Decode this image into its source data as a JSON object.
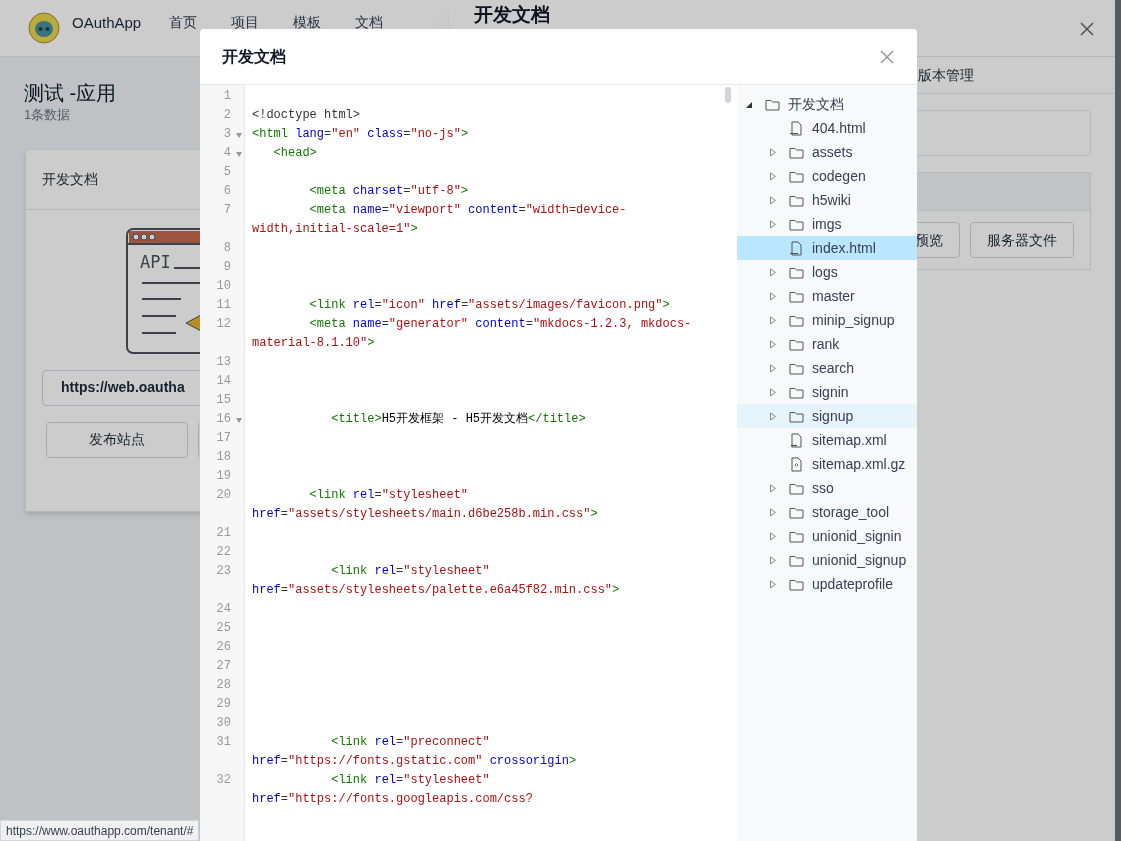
{
  "app": {
    "name": "OAuthApp",
    "nav": [
      {
        "label": "首页"
      },
      {
        "label": "项目"
      },
      {
        "label": "模板"
      },
      {
        "label": "文档"
      }
    ]
  },
  "page": {
    "title": "测试 -应用",
    "subtitle": "1条数据"
  },
  "card": {
    "title": "开发文档",
    "illustration_label": "API",
    "url_button": "https://web.oautha",
    "buttons": [
      "发布站点"
    ]
  },
  "drawer": {
    "title": "开发文档",
    "tabs": [
      {
        "label": "版本管理",
        "selected": false
      }
    ],
    "buttons": [
      "预览",
      "服务器文件"
    ]
  },
  "modal": {
    "title": "开发文档",
    "code_lines": [
      {
        "number": "1",
        "foldable": false
      },
      {
        "number": "2",
        "foldable": false,
        "segments": [
          {
            "kind": "plain",
            "text": "<!doctype html>"
          }
        ]
      },
      {
        "number": "3",
        "foldable": true,
        "segments": [
          {
            "kind": "tag",
            "text": "<html"
          },
          {
            "kind": "attr",
            "text": " lang"
          },
          {
            "kind": "plain",
            "text": "="
          },
          {
            "kind": "value",
            "text": "\"en\""
          },
          {
            "kind": "attr",
            "text": " class"
          },
          {
            "kind": "plain",
            "text": "="
          },
          {
            "kind": "value",
            "text": "\"no-js\""
          },
          {
            "kind": "tag",
            "text": ">"
          }
        ]
      },
      {
        "number": "4",
        "foldable": true,
        "segments": [
          {
            "kind": "tag",
            "text": "   <head>"
          }
        ]
      },
      {
        "number": "5",
        "foldable": false
      },
      {
        "number": "6",
        "foldable": false,
        "segments": [
          {
            "kind": "tag",
            "text": "        <meta"
          },
          {
            "kind": "attr",
            "text": " charset"
          },
          {
            "kind": "plain",
            "text": "="
          },
          {
            "kind": "value",
            "text": "\"utf-8\""
          },
          {
            "kind": "tag",
            "text": ">"
          }
        ]
      },
      {
        "number": "7",
        "foldable": false,
        "segments": [
          {
            "kind": "tag",
            "text": "        <meta"
          },
          {
            "kind": "attr",
            "text": " name"
          },
          {
            "kind": "plain",
            "text": "="
          },
          {
            "kind": "value",
            "text": "\"viewport\""
          },
          {
            "kind": "attr",
            "text": " content"
          },
          {
            "kind": "plain",
            "text": "="
          },
          {
            "kind": "value",
            "text": "\"width=device-width,initial-scale=1\""
          },
          {
            "kind": "tag",
            "text": ">"
          }
        ]
      },
      {
        "number": "8",
        "foldable": false
      },
      {
        "number": "9",
        "foldable": false
      },
      {
        "number": "10",
        "foldable": false
      },
      {
        "number": "11",
        "foldable": false,
        "segments": [
          {
            "kind": "tag",
            "text": "        <link"
          },
          {
            "kind": "attr",
            "text": " rel"
          },
          {
            "kind": "plain",
            "text": "="
          },
          {
            "kind": "value",
            "text": "\"icon\""
          },
          {
            "kind": "attr",
            "text": " href"
          },
          {
            "kind": "plain",
            "text": "="
          },
          {
            "kind": "value",
            "text": "\"assets/images/favicon.png\""
          },
          {
            "kind": "tag",
            "text": ">"
          }
        ]
      },
      {
        "number": "12",
        "foldable": false,
        "segments": [
          {
            "kind": "tag",
            "text": "        <meta"
          },
          {
            "kind": "attr",
            "text": " name"
          },
          {
            "kind": "plain",
            "text": "="
          },
          {
            "kind": "value",
            "text": "\"generator\""
          },
          {
            "kind": "attr",
            "text": " content"
          },
          {
            "kind": "plain",
            "text": "="
          },
          {
            "kind": "value",
            "text": "\"mkdocs-1.2.3, mkdocs-material-8.1.10\""
          },
          {
            "kind": "tag",
            "text": ">"
          }
        ]
      },
      {
        "number": "13",
        "foldable": false
      },
      {
        "number": "14",
        "foldable": false
      },
      {
        "number": "15",
        "foldable": false
      },
      {
        "number": "16",
        "foldable": true,
        "segments": [
          {
            "kind": "tag",
            "text": "           <title>"
          },
          {
            "kind": "text",
            "text": "H5开发框架 - H5开发文档"
          },
          {
            "kind": "tag",
            "text": "</title>"
          }
        ]
      },
      {
        "number": "17",
        "foldable": false
      },
      {
        "number": "18",
        "foldable": false
      },
      {
        "number": "19",
        "foldable": false
      },
      {
        "number": "20",
        "foldable": false,
        "segments": [
          {
            "kind": "tag",
            "text": "        <link"
          },
          {
            "kind": "attr",
            "text": " rel"
          },
          {
            "kind": "plain",
            "text": "="
          },
          {
            "kind": "value",
            "text": "\"stylesheet\""
          },
          {
            "kind": "attr",
            "text": " href"
          },
          {
            "kind": "plain",
            "text": "="
          },
          {
            "kind": "value",
            "text": "\"assets/stylesheets/main.d6be258b.min.css\""
          },
          {
            "kind": "tag",
            "text": ">"
          }
        ]
      },
      {
        "number": "21",
        "foldable": false
      },
      {
        "number": "22",
        "foldable": false
      },
      {
        "number": "23",
        "foldable": false,
        "segments": [
          {
            "kind": "tag",
            "text": "           <link"
          },
          {
            "kind": "attr",
            "text": " rel"
          },
          {
            "kind": "plain",
            "text": "="
          },
          {
            "kind": "value",
            "text": "\"stylesheet\""
          },
          {
            "kind": "attr",
            "text": " href"
          },
          {
            "kind": "plain",
            "text": "="
          },
          {
            "kind": "value",
            "text": "\"assets/stylesheets/palette.e6a45f82.min.css\""
          },
          {
            "kind": "tag",
            "text": ">"
          }
        ]
      },
      {
        "number": "24",
        "foldable": false
      },
      {
        "number": "25",
        "foldable": false
      },
      {
        "number": "26",
        "foldable": false
      },
      {
        "number": "27",
        "foldable": false
      },
      {
        "number": "28",
        "foldable": false
      },
      {
        "number": "29",
        "foldable": false
      },
      {
        "number": "30",
        "foldable": false
      },
      {
        "number": "31",
        "foldable": false,
        "segments": [
          {
            "kind": "tag",
            "text": "           <link"
          },
          {
            "kind": "attr",
            "text": " rel"
          },
          {
            "kind": "plain",
            "text": "="
          },
          {
            "kind": "value",
            "text": "\"preconnect\""
          },
          {
            "kind": "attr",
            "text": " href"
          },
          {
            "kind": "plain",
            "text": "="
          },
          {
            "kind": "value",
            "text": "\"https://fonts.gstatic.com\""
          },
          {
            "kind": "attr",
            "text": " crossorigin"
          },
          {
            "kind": "tag",
            "text": ">"
          }
        ]
      },
      {
        "number": "32",
        "foldable": false,
        "segments": [
          {
            "kind": "tag",
            "text": "           <link"
          },
          {
            "kind": "attr",
            "text": " rel"
          },
          {
            "kind": "plain",
            "text": "="
          },
          {
            "kind": "value",
            "text": "\"stylesheet\""
          },
          {
            "kind": "attr",
            "text": " href"
          },
          {
            "kind": "plain",
            "text": "="
          },
          {
            "kind": "value",
            "text": "\"https://fonts.googleapis.com/css?"
          }
        ]
      }
    ],
    "file_tree": [
      {
        "label": "开发文档",
        "kind": "folder",
        "expanded": true,
        "selected": false,
        "hovered": false,
        "children": [
          {
            "label": "404.html",
            "kind": "html",
            "selected": false,
            "hovered": false
          },
          {
            "label": "assets",
            "kind": "folder",
            "expanded": false,
            "selected": false,
            "hovered": false
          },
          {
            "label": "codegen",
            "kind": "folder",
            "expanded": false,
            "selected": false,
            "hovered": false
          },
          {
            "label": "h5wiki",
            "kind": "folder",
            "expanded": false,
            "selected": false,
            "hovered": false
          },
          {
            "label": "imgs",
            "kind": "folder",
            "expanded": false,
            "selected": false,
            "hovered": false
          },
          {
            "label": "index.html",
            "kind": "html",
            "selected": true,
            "hovered": false
          },
          {
            "label": "logs",
            "kind": "folder",
            "expanded": false,
            "selected": false,
            "hovered": false
          },
          {
            "label": "master",
            "kind": "folder",
            "expanded": false,
            "selected": false,
            "hovered": false
          },
          {
            "label": "minip_signup",
            "kind": "folder",
            "expanded": false,
            "selected": false,
            "hovered": false
          },
          {
            "label": "rank",
            "kind": "folder",
            "expanded": false,
            "selected": false,
            "hovered": false
          },
          {
            "label": "search",
            "kind": "folder",
            "expanded": false,
            "selected": false,
            "hovered": false
          },
          {
            "label": "signin",
            "kind": "folder",
            "expanded": false,
            "selected": false,
            "hovered": false
          },
          {
            "label": "signup",
            "kind": "folder",
            "expanded": false,
            "selected": false,
            "hovered": true
          },
          {
            "label": "sitemap.xml",
            "kind": "xml",
            "selected": false,
            "hovered": false
          },
          {
            "label": "sitemap.xml.gz",
            "kind": "archive",
            "selected": false,
            "hovered": false
          },
          {
            "label": "sso",
            "kind": "folder",
            "expanded": false,
            "selected": false,
            "hovered": false
          },
          {
            "label": "storage_tool",
            "kind": "folder",
            "expanded": false,
            "selected": false,
            "hovered": false
          },
          {
            "label": "unionid_signin",
            "kind": "folder",
            "expanded": false,
            "selected": false,
            "hovered": false
          },
          {
            "label": "unionid_signup",
            "kind": "folder",
            "expanded": false,
            "selected": false,
            "hovered": false
          },
          {
            "label": "updateprofile",
            "kind": "folder",
            "expanded": false,
            "selected": false,
            "hovered": false
          }
        ]
      }
    ]
  },
  "status_bar": {
    "url": "https://www.oauthapp.com/tenant/#"
  }
}
